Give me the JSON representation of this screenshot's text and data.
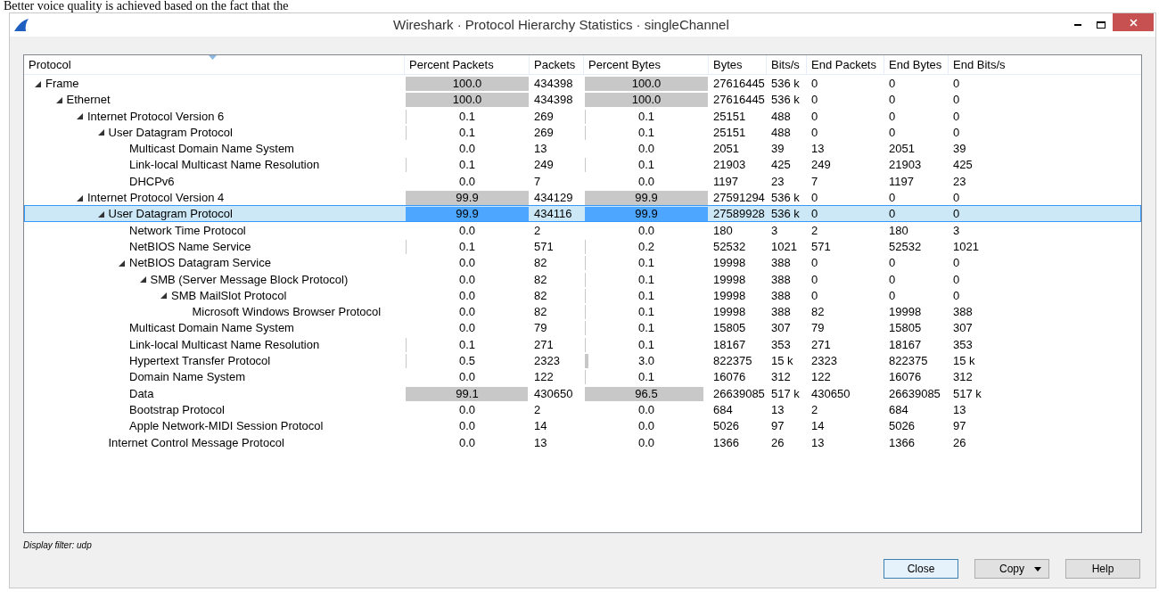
{
  "document_text": "Better voice quality is achieved based on the fact that the",
  "window": {
    "title": "Wireshark · Protocol Hierarchy Statistics · singleChannel"
  },
  "table": {
    "columns": [
      "Protocol",
      "Percent Packets",
      "Packets",
      "Percent Bytes",
      "Bytes",
      "Bits/s",
      "End Packets",
      "End Bytes",
      "End Bits/s"
    ],
    "rows": [
      {
        "protocol": "Frame",
        "percent_packets": "100.0",
        "packets": "434398",
        "percent_bytes": "100.0",
        "bytes": "27616445",
        "bits_s": "536 k",
        "end_packets": "0",
        "end_bytes": "0",
        "end_bits_s": "0",
        "selected": false,
        "expanded": true,
        "children": [
          {
            "protocol": "Ethernet",
            "percent_packets": "100.0",
            "packets": "434398",
            "percent_bytes": "100.0",
            "bytes": "27616445",
            "bits_s": "536 k",
            "end_packets": "0",
            "end_bytes": "0",
            "end_bits_s": "0",
            "selected": false,
            "expanded": true,
            "children": [
              {
                "protocol": "Internet Protocol Version 6",
                "percent_packets": "0.1",
                "packets": "269",
                "percent_bytes": "0.1",
                "bytes": "25151",
                "bits_s": "488",
                "end_packets": "0",
                "end_bytes": "0",
                "end_bits_s": "0",
                "selected": false,
                "expanded": true,
                "children": [
                  {
                    "protocol": "User Datagram Protocol",
                    "percent_packets": "0.1",
                    "packets": "269",
                    "percent_bytes": "0.1",
                    "bytes": "25151",
                    "bits_s": "488",
                    "end_packets": "0",
                    "end_bytes": "0",
                    "end_bits_s": "0",
                    "selected": false,
                    "expanded": true,
                    "children": [
                      {
                        "protocol": "Multicast Domain Name System",
                        "percent_packets": "0.0",
                        "packets": "13",
                        "percent_bytes": "0.0",
                        "bytes": "2051",
                        "bits_s": "39",
                        "end_packets": "13",
                        "end_bytes": "2051",
                        "end_bits_s": "39",
                        "selected": false
                      },
                      {
                        "protocol": "Link-local Multicast Name Resolution",
                        "percent_packets": "0.1",
                        "packets": "249",
                        "percent_bytes": "0.1",
                        "bytes": "21903",
                        "bits_s": "425",
                        "end_packets": "249",
                        "end_bytes": "21903",
                        "end_bits_s": "425",
                        "selected": false
                      },
                      {
                        "protocol": "DHCPv6",
                        "percent_packets": "0.0",
                        "packets": "7",
                        "percent_bytes": "0.0",
                        "bytes": "1197",
                        "bits_s": "23",
                        "end_packets": "7",
                        "end_bytes": "1197",
                        "end_bits_s": "23",
                        "selected": false
                      }
                    ]
                  }
                ]
              },
              {
                "protocol": "Internet Protocol Version 4",
                "percent_packets": "99.9",
                "packets": "434129",
                "percent_bytes": "99.9",
                "bytes": "27591294",
                "bits_s": "536 k",
                "end_packets": "0",
                "end_bytes": "0",
                "end_bits_s": "0",
                "selected": false,
                "expanded": true,
                "children": [
                  {
                    "protocol": "User Datagram Protocol",
                    "percent_packets": "99.9",
                    "packets": "434116",
                    "percent_bytes": "99.9",
                    "bytes": "27589928",
                    "bits_s": "536 k",
                    "end_packets": "0",
                    "end_bytes": "0",
                    "end_bits_s": "0",
                    "selected": true,
                    "expanded": true,
                    "children": [
                      {
                        "protocol": "Network Time Protocol",
                        "percent_packets": "0.0",
                        "packets": "2",
                        "percent_bytes": "0.0",
                        "bytes": "180",
                        "bits_s": "3",
                        "end_packets": "2",
                        "end_bytes": "180",
                        "end_bits_s": "3",
                        "selected": false
                      },
                      {
                        "protocol": "NetBIOS Name Service",
                        "percent_packets": "0.1",
                        "packets": "571",
                        "percent_bytes": "0.2",
                        "bytes": "52532",
                        "bits_s": "1021",
                        "end_packets": "571",
                        "end_bytes": "52532",
                        "end_bits_s": "1021",
                        "selected": false
                      },
                      {
                        "protocol": "NetBIOS Datagram Service",
                        "percent_packets": "0.0",
                        "packets": "82",
                        "percent_bytes": "0.1",
                        "bytes": "19998",
                        "bits_s": "388",
                        "end_packets": "0",
                        "end_bytes": "0",
                        "end_bits_s": "0",
                        "selected": false,
                        "expanded": true,
                        "children": [
                          {
                            "protocol": "SMB (Server Message Block Protocol)",
                            "percent_packets": "0.0",
                            "packets": "82",
                            "percent_bytes": "0.1",
                            "bytes": "19998",
                            "bits_s": "388",
                            "end_packets": "0",
                            "end_bytes": "0",
                            "end_bits_s": "0",
                            "selected": false,
                            "expanded": true,
                            "children": [
                              {
                                "protocol": "SMB MailSlot Protocol",
                                "percent_packets": "0.0",
                                "packets": "82",
                                "percent_bytes": "0.1",
                                "bytes": "19998",
                                "bits_s": "388",
                                "end_packets": "0",
                                "end_bytes": "0",
                                "end_bits_s": "0",
                                "selected": false,
                                "expanded": true,
                                "children": [
                                  {
                                    "protocol": "Microsoft Windows Browser Protocol",
                                    "percent_packets": "0.0",
                                    "packets": "82",
                                    "percent_bytes": "0.1",
                                    "bytes": "19998",
                                    "bits_s": "388",
                                    "end_packets": "82",
                                    "end_bytes": "19998",
                                    "end_bits_s": "388",
                                    "selected": false
                                  }
                                ]
                              }
                            ]
                          }
                        ]
                      },
                      {
                        "protocol": "Multicast Domain Name System",
                        "percent_packets": "0.0",
                        "packets": "79",
                        "percent_bytes": "0.1",
                        "bytes": "15805",
                        "bits_s": "307",
                        "end_packets": "79",
                        "end_bytes": "15805",
                        "end_bits_s": "307",
                        "selected": false
                      },
                      {
                        "protocol": "Link-local Multicast Name Resolution",
                        "percent_packets": "0.1",
                        "packets": "271",
                        "percent_bytes": "0.1",
                        "bytes": "18167",
                        "bits_s": "353",
                        "end_packets": "271",
                        "end_bytes": "18167",
                        "end_bits_s": "353",
                        "selected": false
                      },
                      {
                        "protocol": "Hypertext Transfer Protocol",
                        "percent_packets": "0.5",
                        "packets": "2323",
                        "percent_bytes": "3.0",
                        "bytes": "822375",
                        "bits_s": "15 k",
                        "end_packets": "2323",
                        "end_bytes": "822375",
                        "end_bits_s": "15 k",
                        "selected": false
                      },
                      {
                        "protocol": "Domain Name System",
                        "percent_packets": "0.0",
                        "packets": "122",
                        "percent_bytes": "0.1",
                        "bytes": "16076",
                        "bits_s": "312",
                        "end_packets": "122",
                        "end_bytes": "16076",
                        "end_bits_s": "312",
                        "selected": false
                      },
                      {
                        "protocol": "Data",
                        "percent_packets": "99.1",
                        "packets": "430650",
                        "percent_bytes": "96.5",
                        "bytes": "26639085",
                        "bits_s": "517 k",
                        "end_packets": "430650",
                        "end_bytes": "26639085",
                        "end_bits_s": "517 k",
                        "selected": false
                      },
                      {
                        "protocol": "Bootstrap Protocol",
                        "percent_packets": "0.0",
                        "packets": "2",
                        "percent_bytes": "0.0",
                        "bytes": "684",
                        "bits_s": "13",
                        "end_packets": "2",
                        "end_bytes": "684",
                        "end_bits_s": "13",
                        "selected": false
                      },
                      {
                        "protocol": "Apple Network-MIDI Session Protocol",
                        "percent_packets": "0.0",
                        "packets": "14",
                        "percent_bytes": "0.0",
                        "bytes": "5026",
                        "bits_s": "97",
                        "end_packets": "14",
                        "end_bytes": "5026",
                        "end_bits_s": "97",
                        "selected": false
                      }
                    ]
                  },
                  {
                    "protocol": "Internet Control Message Protocol",
                    "percent_packets": "0.0",
                    "packets": "13",
                    "percent_bytes": "0.0",
                    "bytes": "1366",
                    "bits_s": "26",
                    "end_packets": "13",
                    "end_bytes": "1366",
                    "end_bits_s": "26",
                    "selected": false
                  }
                ]
              }
            ]
          }
        ]
      }
    ]
  },
  "status": {
    "display_filter": "Display filter: udp"
  },
  "buttons": [
    {
      "label": "Close",
      "kind": "default"
    },
    {
      "label": "Copy",
      "kind": "menu"
    },
    {
      "label": "Help",
      "kind": "plain"
    }
  ]
}
